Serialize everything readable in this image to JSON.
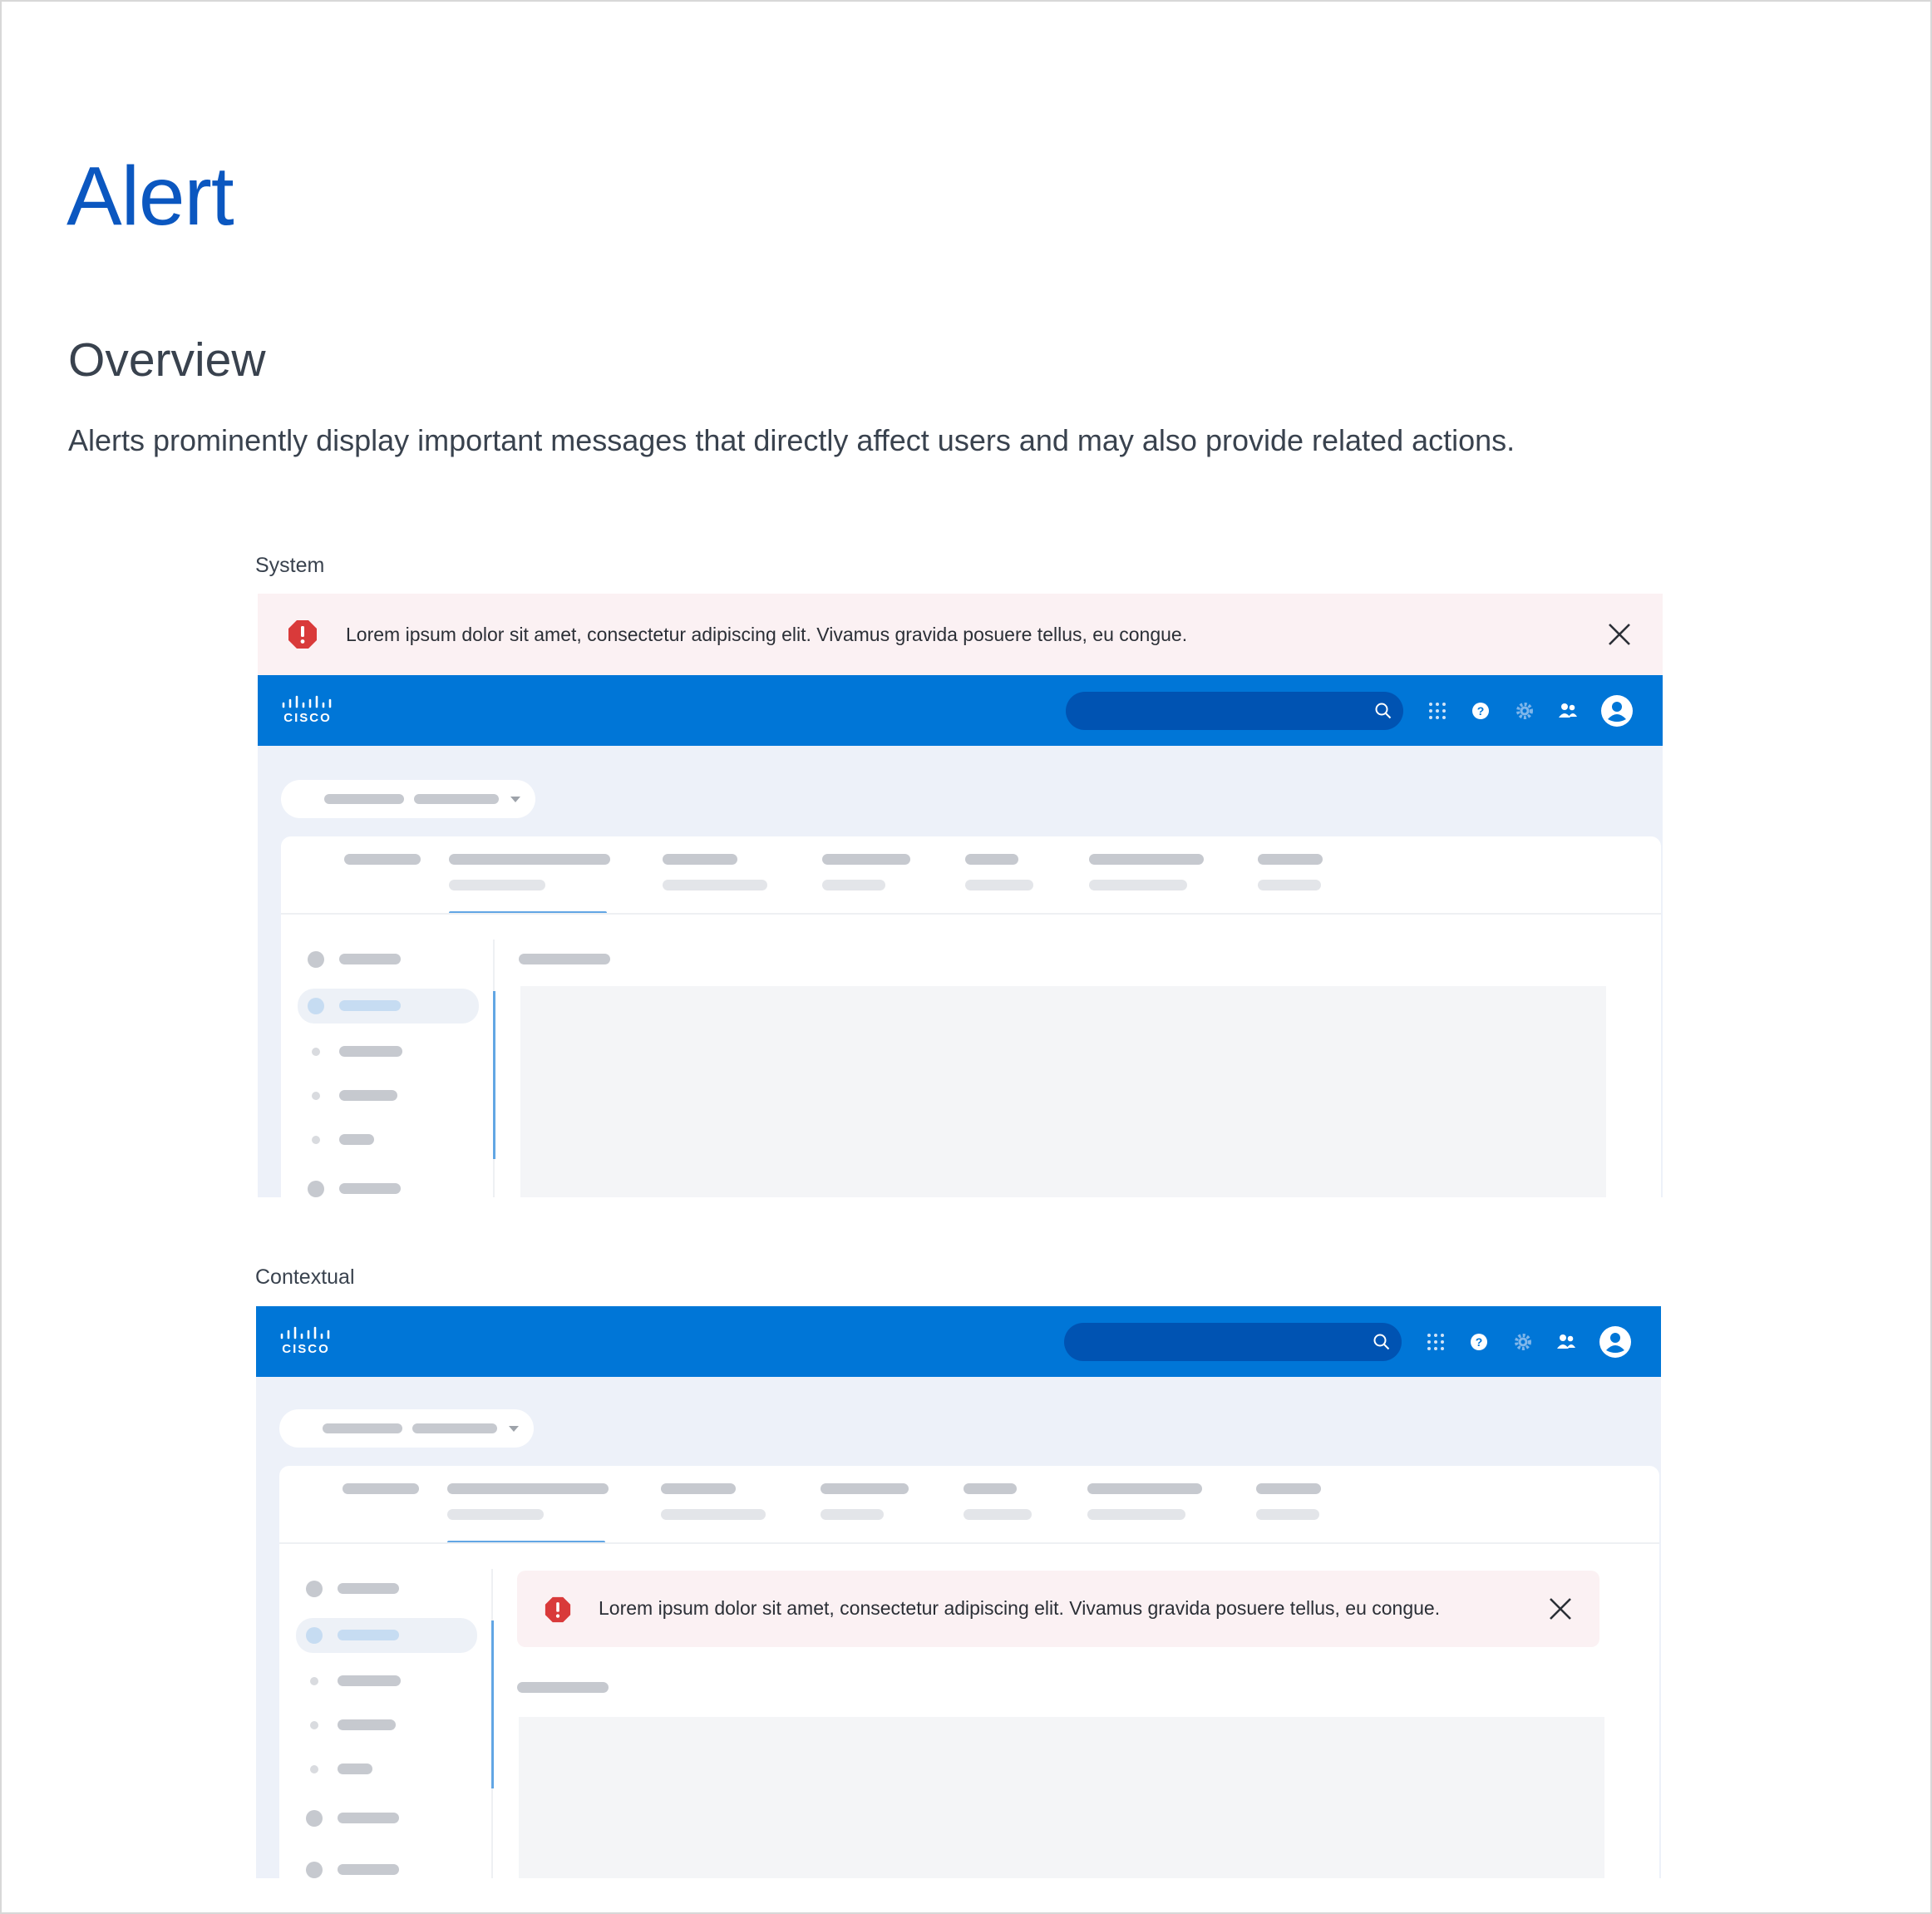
{
  "page": {
    "title": "Alert",
    "section_title": "Overview",
    "description": "Alerts prominently display important messages that directly affect users and may also provide related actions."
  },
  "examples": {
    "system": {
      "label": "System",
      "alert_text": "Lorem ipsum dolor sit amet, consectetur adipiscing elit. Vivamus gravida posuere tellus, eu congue."
    },
    "contextual": {
      "label": "Contextual",
      "alert_text": "Lorem ipsum dolor sit amet, consectetur adipiscing elit. Vivamus gravida posuere tellus, eu congue."
    }
  },
  "mock_app": {
    "logo_text": "CISCO",
    "icons": [
      "search-icon",
      "app-grid-icon",
      "help-icon",
      "gear-icon",
      "people-icon",
      "avatar-icon"
    ]
  },
  "colors": {
    "title_blue": "#0b57c0",
    "header_blue": "#0076d7",
    "search_blue": "#0053b2",
    "alert_bg": "#fbf1f3",
    "alert_red": "#d93a3a",
    "app_bg": "#edf1f9"
  }
}
